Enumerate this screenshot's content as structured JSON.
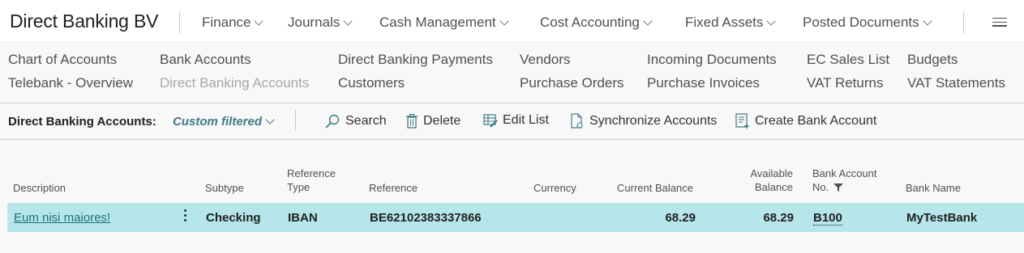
{
  "header": {
    "company": "Direct Banking BV",
    "menu": [
      {
        "label": "Finance"
      },
      {
        "label": "Journals"
      },
      {
        "label": "Cash Management"
      },
      {
        "label": "Cost Accounting"
      },
      {
        "label": "Fixed Assets"
      },
      {
        "label": "Posted Documents"
      }
    ]
  },
  "quick_links": {
    "col1": [
      "Chart of Accounts",
      "Telebank - Overview"
    ],
    "col2": [
      "Bank Accounts",
      "Direct Banking Accounts"
    ],
    "col3": [
      "Direct Banking Payments",
      "Customers"
    ],
    "col4": [
      "Vendors",
      "Purchase Orders"
    ],
    "col5": [
      "Incoming Documents",
      "Purchase Invoices"
    ],
    "col6": [
      "EC Sales List",
      "VAT Returns"
    ],
    "col7": [
      "Budgets",
      "VAT Statements"
    ]
  },
  "action_bar": {
    "title": "Direct Banking Accounts:",
    "filter": "Custom filtered",
    "search": "Search",
    "delete": "Delete",
    "edit_list": "Edit List",
    "synchronize": "Synchronize Accounts",
    "create": "Create Bank Account"
  },
  "table": {
    "headers": {
      "description": "Description",
      "subtype": "Subtype",
      "reference_type_1": "Reference",
      "reference_type_2": "Type",
      "reference": "Reference",
      "currency": "Currency",
      "current_balance": "Current Balance",
      "available_balance_1": "Available",
      "available_balance_2": "Balance",
      "bank_account_no_1": "Bank Account",
      "bank_account_no_2": "No.",
      "bank_name": "Bank Name"
    },
    "rows": [
      {
        "description": "Eum nisi maiores!",
        "subtype": "Checking",
        "reference_type": "IBAN",
        "reference": "BE62102383337866",
        "currency": "",
        "current_balance": "68.29",
        "available_balance": "68.29",
        "bank_account_no": "B100",
        "bank_name": "MyTestBank"
      }
    ]
  },
  "colors": {
    "accent": "#3f7a85",
    "selected_row": "#b6e6ea",
    "link": "#1e6f7a"
  }
}
